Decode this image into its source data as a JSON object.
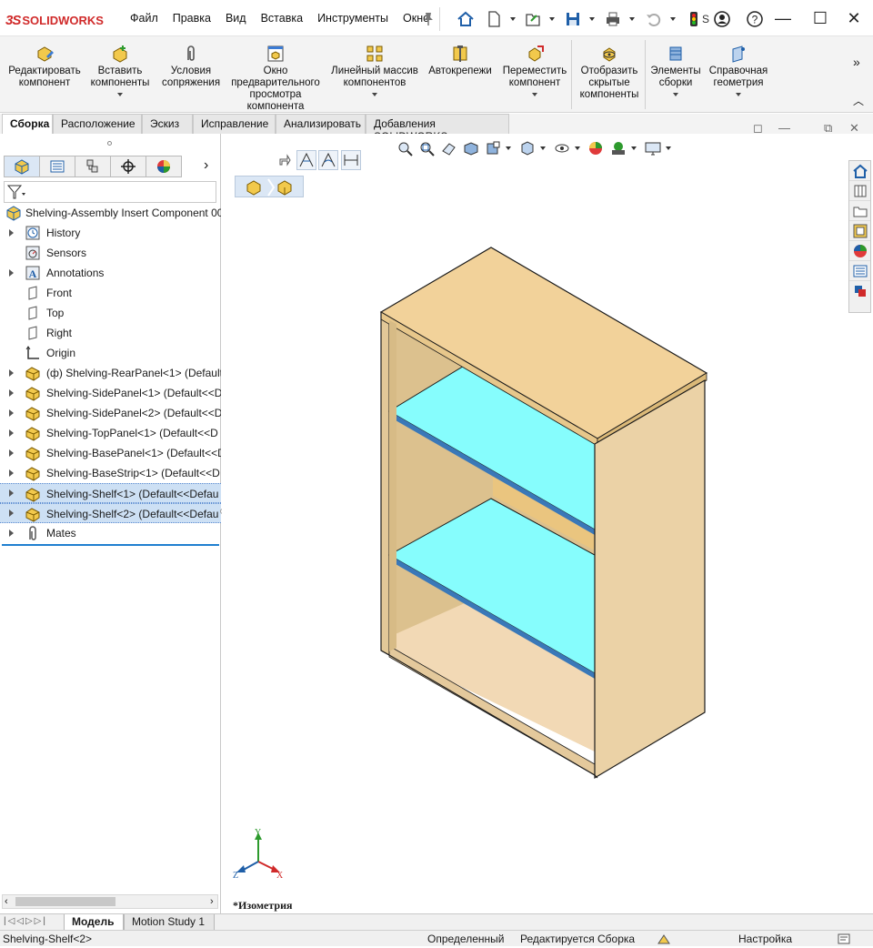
{
  "app": {
    "logo_prefix": "3S",
    "logo_name": "SOLIDWORKS"
  },
  "menu": [
    "Файл",
    "Правка",
    "Вид",
    "Вставка",
    "Инструменты",
    "Окно"
  ],
  "quick_access": {
    "truncated_label": "S"
  },
  "ribbon": {
    "buttons": [
      {
        "label": "Редактировать\nкомпонент"
      },
      {
        "label": "Вставить\nкомпоненты"
      },
      {
        "label": "Условия\nсопряжения"
      },
      {
        "label": "Окно\nпредварительного\nпросмотра\nкомпонента"
      },
      {
        "label": "Линейный массив\nкомпонентов"
      },
      {
        "label": "Автокрепежи"
      },
      {
        "label": "Переместить\nкомпонент"
      },
      {
        "label": "Отобразить\nскрытые\nкомпоненты"
      },
      {
        "label": "Элементы\nсборки"
      },
      {
        "label": "Справочная\nгеометрия"
      }
    ]
  },
  "command_tabs": [
    "Сборка",
    "Расположение",
    "Эскиз",
    "Исправление",
    "Анализировать",
    "Добавления SOLIDWORKS"
  ],
  "tree": {
    "root": "Shelving-Assembly Insert Component 00",
    "items": [
      {
        "label": "History"
      },
      {
        "label": "Sensors"
      },
      {
        "label": "Annotations"
      },
      {
        "label": "Front"
      },
      {
        "label": "Top"
      },
      {
        "label": "Right"
      },
      {
        "label": "Origin"
      },
      {
        "label": "(ф) Shelving-RearPanel<1> (Default"
      },
      {
        "label": "Shelving-SidePanel<1> (Default<<D"
      },
      {
        "label": "Shelving-SidePanel<2> (Default<<D"
      },
      {
        "label": "Shelving-TopPanel<1> (Default<<D"
      },
      {
        "label": "Shelving-BasePanel<1> (Default<<D"
      },
      {
        "label": "Shelving-BaseStrip<1> (Default<<D"
      },
      {
        "label": "Shelving-Shelf<1> (Default<<Defau"
      },
      {
        "label": "Shelving-Shelf<2> (Default<<Defau"
      },
      {
        "label": "Mates"
      }
    ]
  },
  "viewport": {
    "view_name": "*Изометрия",
    "triad": {
      "x": "X",
      "y": "Y",
      "z": "Z"
    },
    "colors": {
      "wood_top": "#f2d29a",
      "wood_side": "#ecd2a6",
      "wood_inner": "#dcc18e",
      "shelf": "#86fdfd",
      "edge": "#1a1a1a"
    }
  },
  "bottom_tabs": [
    "Модель",
    "Motion Study 1"
  ],
  "status": {
    "selection": "Shelving-Shelf<2>",
    "state": "Определенный",
    "mode": "Редактируется Сборка",
    "custom": "Настройка"
  }
}
